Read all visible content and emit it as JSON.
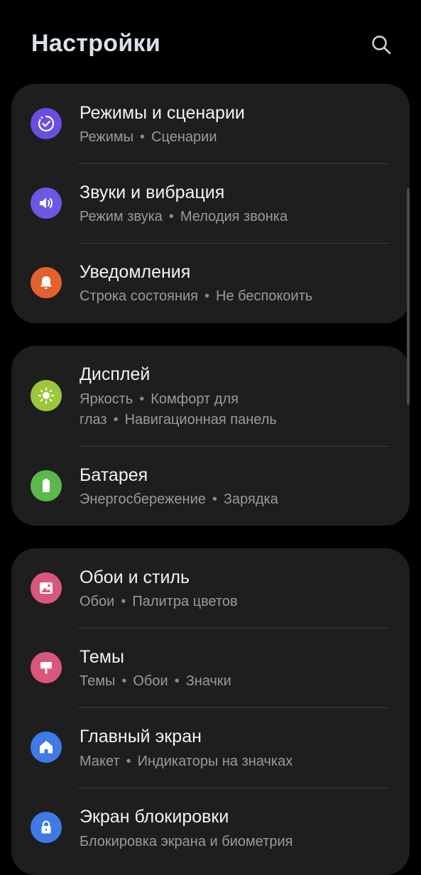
{
  "header": {
    "title": "Настройки"
  },
  "icons": {
    "search": "search-icon",
    "modes": "routine-check-icon",
    "sounds": "speaker-icon",
    "notifications": "bell-icon",
    "display": "sun-icon",
    "battery": "battery-icon",
    "wallpaper": "image-icon",
    "themes": "brush-icon",
    "home": "home-icon",
    "lock": "lock-icon"
  },
  "colors": {
    "background": "#000000",
    "card": "#1e1e1e",
    "modes": "#6a4ee0",
    "sounds": "#6b57e6",
    "notifications": "#e2612d",
    "display": "#9bc83a",
    "battery": "#5bb84a",
    "wallpaper": "#d9577a",
    "themes": "#d9577a",
    "home": "#3f7ae6",
    "lock": "#3f7ae6"
  },
  "groups": [
    {
      "items": [
        {
          "title": "Режимы и сценарии",
          "subtitle": [
            "Режимы",
            "Сценарии"
          ]
        },
        {
          "title": "Звуки и вибрация",
          "subtitle": [
            "Режим звука",
            "Мелодия звонка"
          ]
        },
        {
          "title": "Уведомления",
          "subtitle": [
            "Строка состояния",
            "Не беспокоить"
          ]
        }
      ]
    },
    {
      "items": [
        {
          "title": "Дисплей",
          "subtitle": [
            "Яркость",
            "Комфорт для глаз",
            "Навигационная панель"
          ]
        },
        {
          "title": "Батарея",
          "subtitle": [
            "Энергосбережение",
            "Зарядка"
          ]
        }
      ]
    },
    {
      "items": [
        {
          "title": "Обои и стиль",
          "subtitle": [
            "Обои",
            "Палитра цветов"
          ]
        },
        {
          "title": "Темы",
          "subtitle": [
            "Темы",
            "Обои",
            "Значки"
          ]
        },
        {
          "title": "Главный экран",
          "subtitle": [
            "Макет",
            "Индикаторы на значках"
          ]
        },
        {
          "title": "Экран блокировки",
          "subtitle": [
            "Блокировка экрана и биометрия"
          ]
        }
      ]
    }
  ]
}
